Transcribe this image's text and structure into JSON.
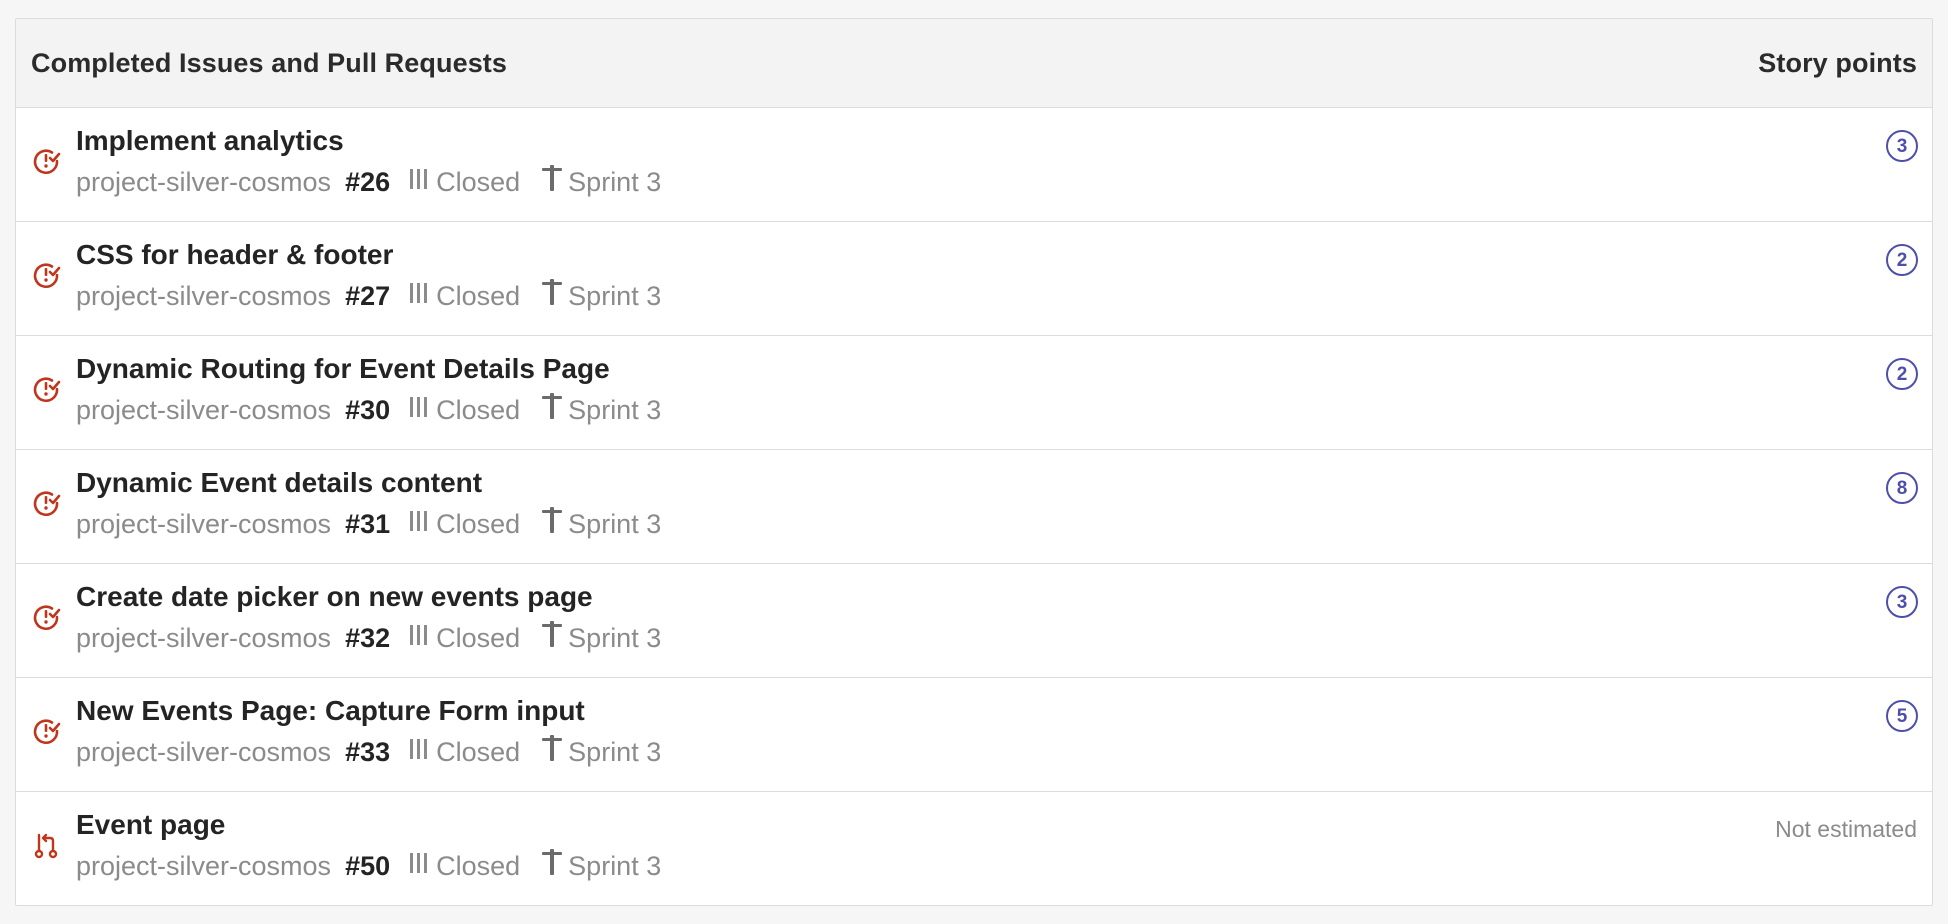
{
  "header": {
    "title": "Completed Issues and Pull Requests",
    "points_label": "Story points"
  },
  "colors": {
    "issue_icon": "#c0361d",
    "points_badge": "#4d4faa",
    "muted_text": "#8b8b8b",
    "strong_text": "#242424"
  },
  "rows": [
    {
      "kind": "issue",
      "icon": "issue-closed-icon",
      "title": "Implement analytics",
      "repo": "project-silver-cosmos",
      "number": "#26",
      "state": "Closed",
      "sprint": "Sprint 3",
      "points": "3"
    },
    {
      "kind": "issue",
      "icon": "issue-closed-icon",
      "title": "CSS for header & footer",
      "repo": "project-silver-cosmos",
      "number": "#27",
      "state": "Closed",
      "sprint": "Sprint 3",
      "points": "2"
    },
    {
      "kind": "issue",
      "icon": "issue-closed-icon",
      "title": "Dynamic Routing for Event Details Page",
      "repo": "project-silver-cosmos",
      "number": "#30",
      "state": "Closed",
      "sprint": "Sprint 3",
      "points": "2"
    },
    {
      "kind": "issue",
      "icon": "issue-closed-icon",
      "title": "Dynamic Event details content",
      "repo": "project-silver-cosmos",
      "number": "#31",
      "state": "Closed",
      "sprint": "Sprint 3",
      "points": "8"
    },
    {
      "kind": "issue",
      "icon": "issue-closed-icon",
      "title": "Create date picker on new events page",
      "repo": "project-silver-cosmos",
      "number": "#32",
      "state": "Closed",
      "sprint": "Sprint 3",
      "points": "3"
    },
    {
      "kind": "issue",
      "icon": "issue-closed-icon",
      "title": "New Events Page: Capture Form input",
      "repo": "project-silver-cosmos",
      "number": "#33",
      "state": "Closed",
      "sprint": "Sprint 3",
      "points": "5"
    },
    {
      "kind": "pull_request",
      "icon": "pull-request-icon",
      "title": "Event page",
      "repo": "project-silver-cosmos",
      "number": "#50",
      "state": "Closed",
      "sprint": "Sprint 3",
      "points_text": "Not estimated"
    }
  ]
}
